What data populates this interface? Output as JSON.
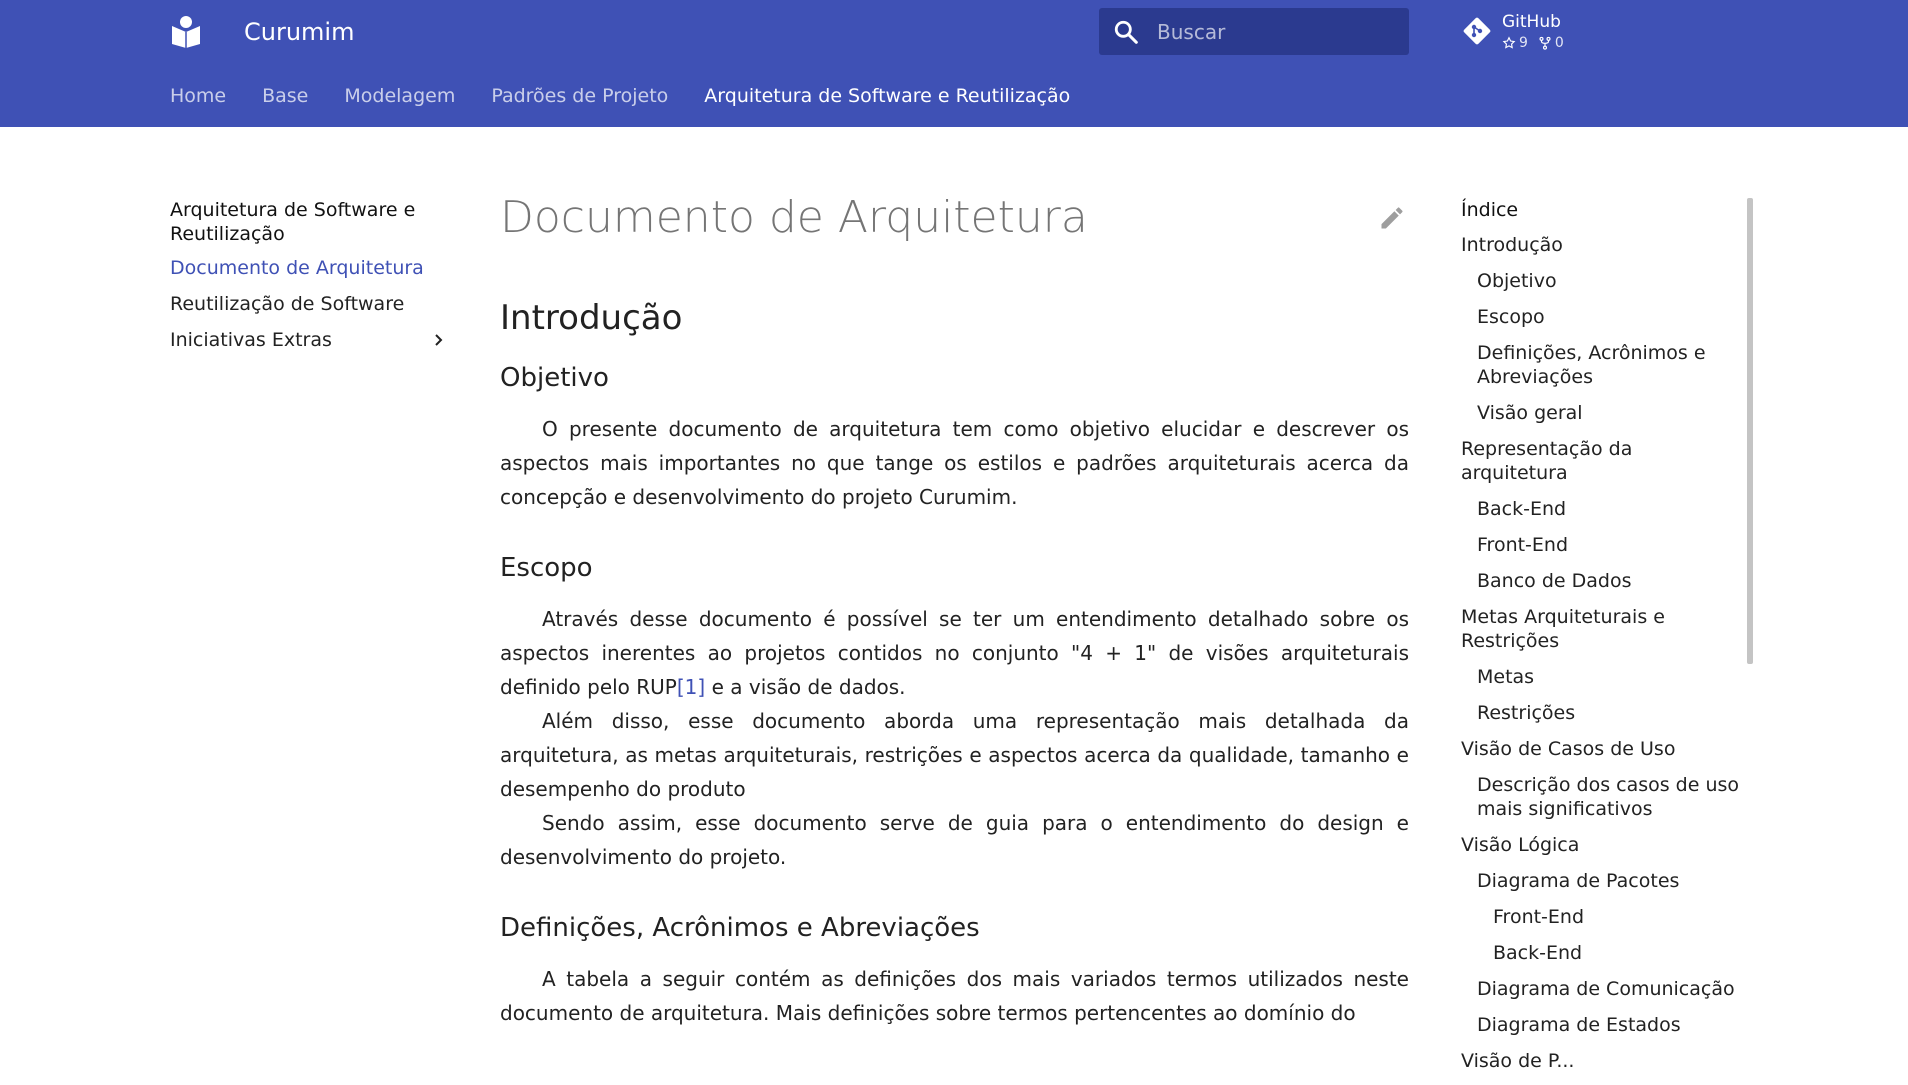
{
  "header": {
    "site_title": "Curumim",
    "search_placeholder": "Buscar",
    "repo": {
      "name": "GitHub",
      "stars": "9",
      "forks": "0"
    },
    "tabs": [
      {
        "label": "Home"
      },
      {
        "label": "Base"
      },
      {
        "label": "Modelagem"
      },
      {
        "label": "Padrões de Projeto"
      },
      {
        "label": "Arquitetura de Software e Reutilização"
      }
    ],
    "colors": {
      "primary": "#3f51b5",
      "search_bg": "#2b3a8f"
    }
  },
  "nav": {
    "title": "Arquitetura de Software e Reutilização",
    "items": [
      {
        "label": "Documento de Arquitetura"
      },
      {
        "label": "Reutilização de Software"
      },
      {
        "label": "Iniciativas Extras"
      }
    ]
  },
  "content": {
    "page_title": "Documento de Arquitetura",
    "h2_intro": "Introdução",
    "h3_objetivo": "Objetivo",
    "p_objetivo": "O presente documento de arquitetura tem como objetivo elucidar e descrever os aspectos mais importantes no que tange os estilos e padrões arquiteturais acerca da concepção e desenvolvimento do projeto Curumim.",
    "h3_escopo": "Escopo",
    "p_escopo1_a": "Através desse documento é possível se ter um entendimento detalhado sobre os aspectos inerentes ao projetos contidos no conjunto \"4 + 1\" de visões arquiteturais definido pelo RUP",
    "p_escopo1_ref": "[1]",
    "p_escopo1_b": " e a visão de dados.",
    "p_escopo2": "Além disso, esse documento aborda uma representação mais detalhada da arquitetura, as metas arquiteturais, restrições e aspectos acerca da qualidade, tamanho e desempenho do produto",
    "p_escopo3": "Sendo assim, esse documento serve de guia para o entendimento do design e desenvolvimento do projeto.",
    "h3_definicoes": "Definições, Acrônimos e Abreviações",
    "p_definicoes": "A tabela a seguir contém as definições dos mais variados termos utilizados neste documento de arquitetura. Mais definições sobre termos pertencentes ao domínio do"
  },
  "toc": {
    "title": "Índice",
    "items": [
      {
        "label": "Introdução",
        "level": 1
      },
      {
        "label": "Objetivo",
        "level": 2
      },
      {
        "label": "Escopo",
        "level": 2
      },
      {
        "label": "Definições, Acrônimos e Abreviações",
        "level": 2
      },
      {
        "label": "Visão geral",
        "level": 2
      },
      {
        "label": "Representação da arquitetura",
        "level": 1
      },
      {
        "label": "Back-End",
        "level": 2
      },
      {
        "label": "Front-End",
        "level": 2
      },
      {
        "label": "Banco de Dados",
        "level": 2
      },
      {
        "label": "Metas Arquiteturais e Restrições",
        "level": 1
      },
      {
        "label": "Metas",
        "level": 2
      },
      {
        "label": "Restrições",
        "level": 2
      },
      {
        "label": "Visão de Casos de Uso",
        "level": 1
      },
      {
        "label": "Descrição dos casos de uso mais significativos",
        "level": 2
      },
      {
        "label": "Visão Lógica",
        "level": 1
      },
      {
        "label": "Diagrama de Pacotes",
        "level": 2
      },
      {
        "label": "Front-End",
        "level": 3
      },
      {
        "label": "Back-End",
        "level": 3
      },
      {
        "label": "Diagrama de Comunicação",
        "level": 2
      },
      {
        "label": "Diagrama de Estados",
        "level": 2
      },
      {
        "label": "Visão de P...",
        "level": 1
      }
    ]
  }
}
